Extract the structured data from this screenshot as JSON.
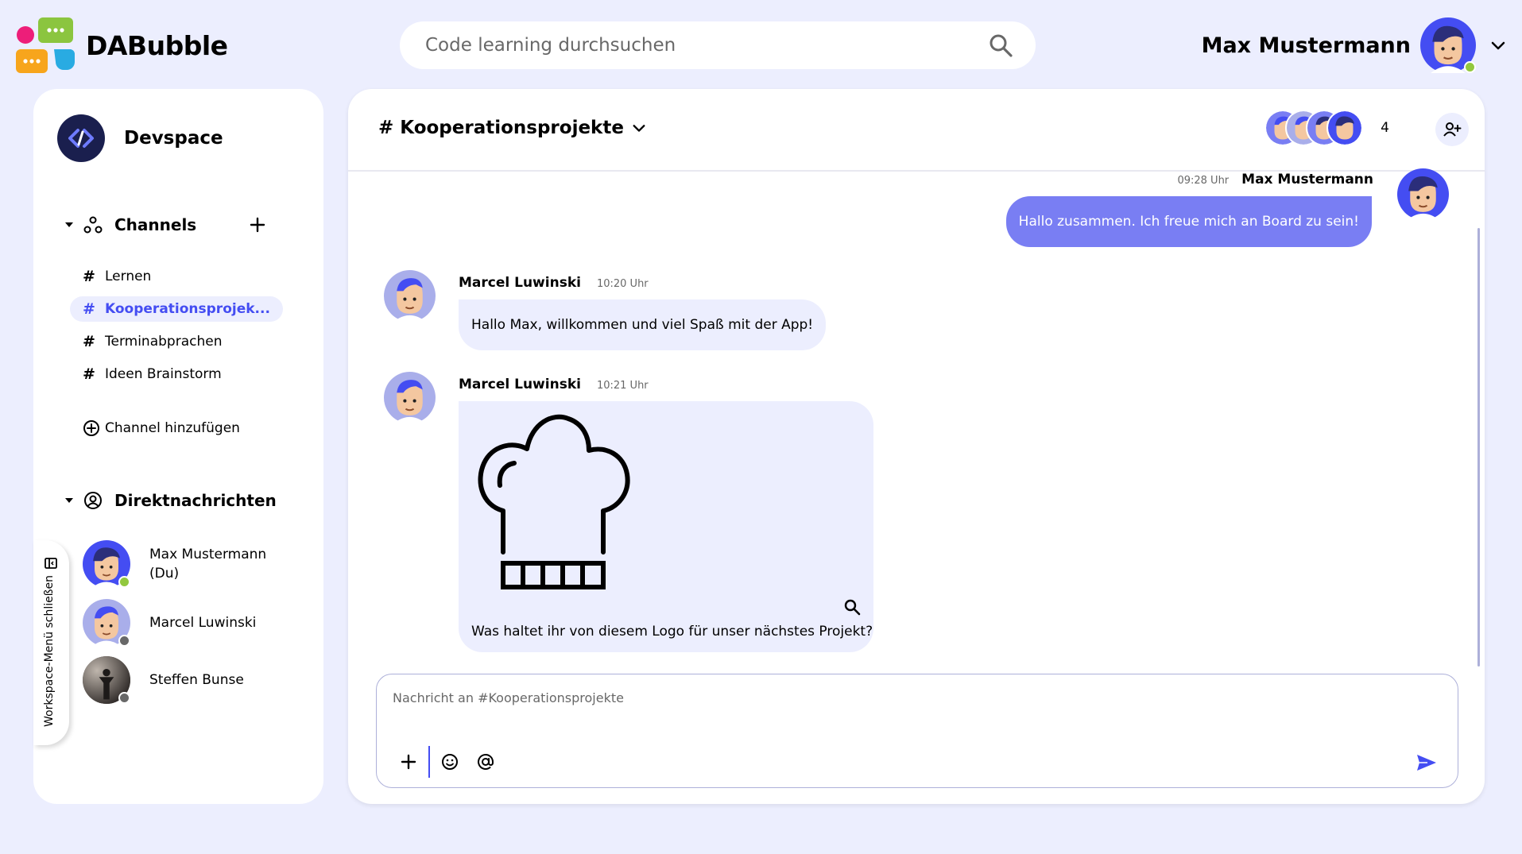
{
  "app": {
    "name": "DABubble"
  },
  "search": {
    "placeholder": "Code learning durchsuchen"
  },
  "user": {
    "name": "Max Mustermann",
    "status": "online"
  },
  "workspace": {
    "name": "Devspace"
  },
  "sidebar": {
    "channels_label": "Channels",
    "channels": [
      {
        "label": "Lernen",
        "active": false
      },
      {
        "label": "Kooperationsprojek...",
        "active": true
      },
      {
        "label": "Terminabprachen",
        "active": false
      },
      {
        "label": "Ideen Brainstorm",
        "active": false
      }
    ],
    "add_channel_label": "Channel hinzufügen",
    "dm_label": "Direktnachrichten",
    "dms": [
      {
        "name": "Max Mustermann (Du)",
        "status": "online"
      },
      {
        "name": "Marcel Luwinski",
        "status": "offline"
      },
      {
        "name": "Steffen Bunse",
        "status": "offline"
      }
    ],
    "collapse_label": "Workspace-Menü schließen"
  },
  "chat": {
    "channel_title": "# Kooperationsprojekte",
    "member_count": "4",
    "messages": [
      {
        "author": "Max Mustermann",
        "time": "09:28 Uhr",
        "text": "Hallo zusammen. Ich freue mich an Board zu sein!",
        "own": true
      },
      {
        "author": "Marcel Luwinski",
        "time": "10:20 Uhr",
        "text": "Hallo Max, willkommen und viel Spaß mit der App!",
        "own": false
      },
      {
        "author": "Marcel Luwinski",
        "time": "10:21 Uhr",
        "text": "Was haltet ihr von diesem Logo für unser nächstes Projekt?",
        "own": false,
        "attachment": "chef-hat-logo"
      }
    ],
    "composer_placeholder": "Nachricht an #Kooperationsprojekte"
  },
  "colors": {
    "background": "#ECEEFE",
    "accent": "#444DF2",
    "own_bubble": "#797EF3",
    "online": "#92C83E",
    "offline": "#686868"
  }
}
